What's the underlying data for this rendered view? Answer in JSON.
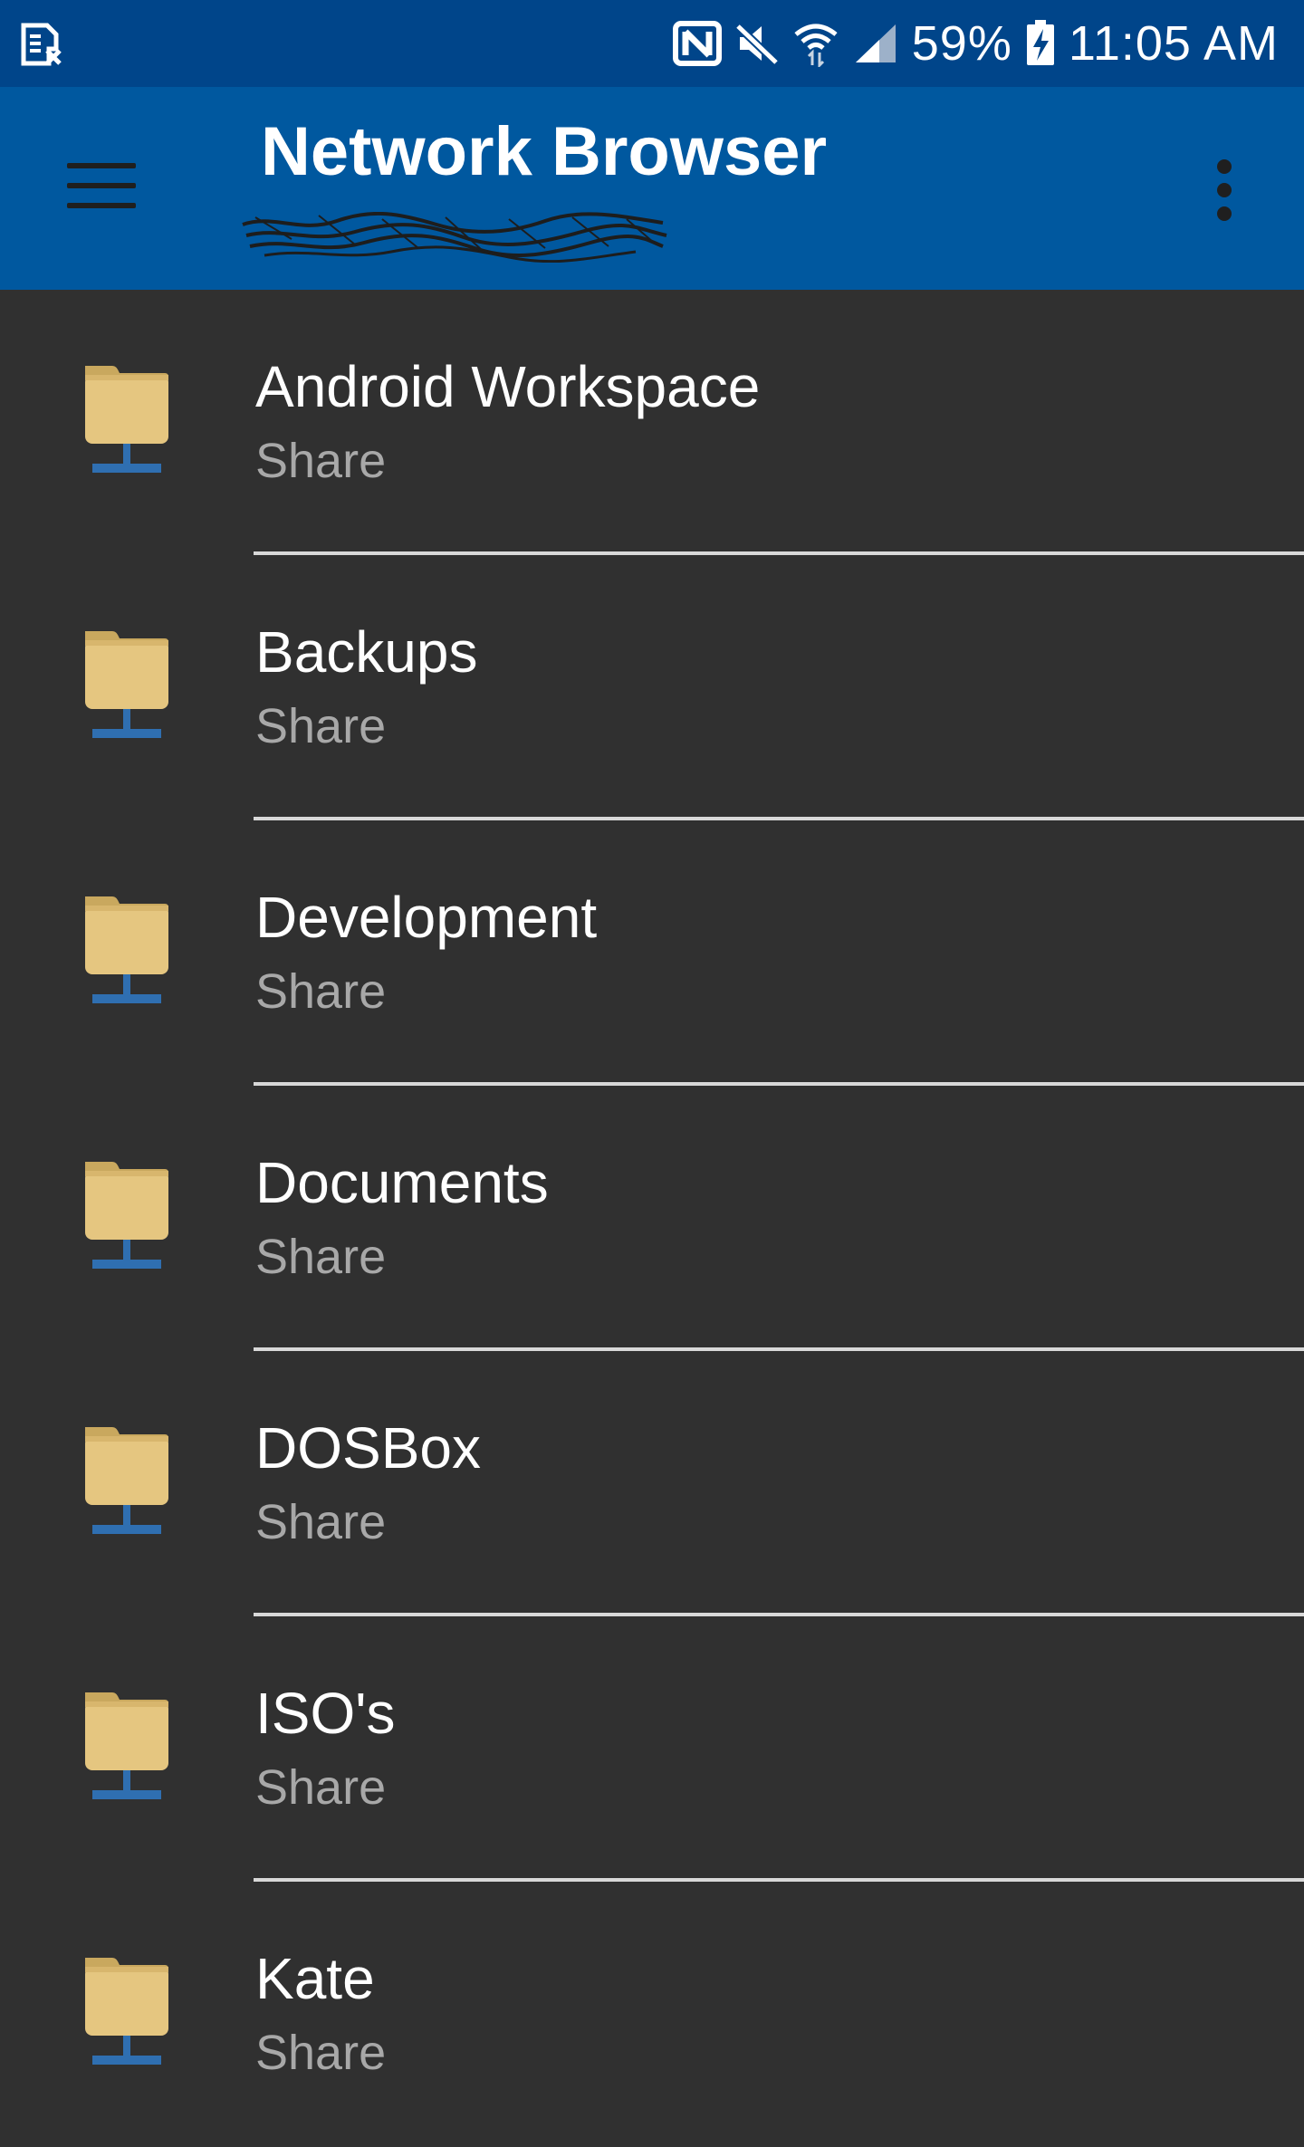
{
  "status_bar": {
    "left_icon": "sim-card-error-icon",
    "icons": [
      "nfc-icon",
      "mute-icon",
      "wifi-icon",
      "signal-icon",
      "battery-charging-icon"
    ],
    "battery": "59%",
    "time": "11:05 AM"
  },
  "app_bar": {
    "title": "Network Browser",
    "menu_icon": "hamburger-menu-icon",
    "overflow_icon": "more-vert-icon"
  },
  "colors": {
    "status_bar": "#00458a",
    "app_bar": "#00589f",
    "background": "#303030",
    "folder": "#e5c680",
    "network_stand": "#2f6fb1"
  },
  "shares": [
    {
      "name": "Android Workspace",
      "type": "Share"
    },
    {
      "name": "Backups",
      "type": "Share"
    },
    {
      "name": "Development",
      "type": "Share"
    },
    {
      "name": "Documents",
      "type": "Share"
    },
    {
      "name": "DOSBox",
      "type": "Share"
    },
    {
      "name": "ISO's",
      "type": "Share"
    },
    {
      "name": "Kate",
      "type": "Share"
    }
  ]
}
